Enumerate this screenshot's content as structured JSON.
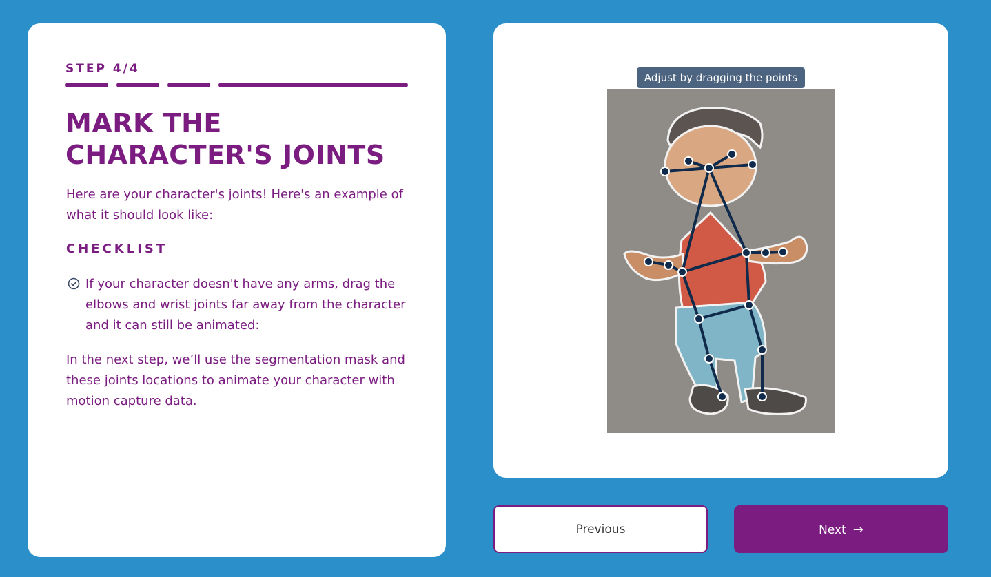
{
  "step": {
    "label": "STEP 4/4",
    "current": 4,
    "total": 4
  },
  "title": {
    "line1": "MARK THE",
    "line2": "CHARACTER'S JOINTS"
  },
  "intro": "Here are your character's joints! Here's an example of what it should look like:",
  "checklist": {
    "heading": "CHECKLIST",
    "items": [
      {
        "text": "If your character doesn't have any arms, drag the elbows and wrist joints far away from the character and it can still be animated:"
      }
    ]
  },
  "outro": "In the next step, we’ll use the segmentation mask and these joints locations to animate your character with motion capture data.",
  "editor": {
    "tooltip": "Adjust by dragging the points"
  },
  "buttons": {
    "previous": "Previous",
    "next": "Next",
    "next_icon": "arrow-right-icon"
  },
  "colors": {
    "background": "#2b8fc9",
    "accent": "#7b1c80",
    "skeleton": "#0f2a4a",
    "tooltip": "#4d6480"
  }
}
